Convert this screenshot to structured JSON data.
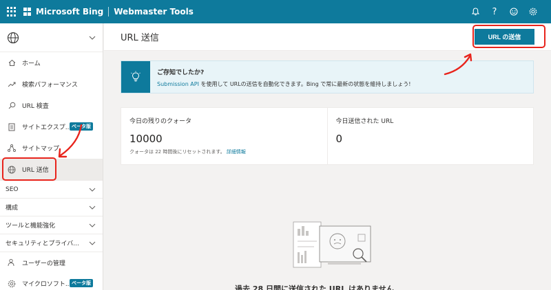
{
  "header": {
    "brand": "Microsoft Bing",
    "product": "Webmaster Tools",
    "icons": [
      "bell-icon",
      "help-icon",
      "smiley-icon",
      "gear-icon"
    ],
    "accent": "#0e7a9c"
  },
  "sidebar": {
    "items": [
      {
        "label": "ホーム",
        "icon": "home-icon"
      },
      {
        "label": "検索パフォーマンス",
        "icon": "trend-icon"
      },
      {
        "label": "URL 検査",
        "icon": "search-icon"
      },
      {
        "label": "サイトエクスプ...",
        "icon": "document-icon",
        "badge": "ベータ版"
      },
      {
        "label": "サイトマップ",
        "icon": "sitemap-icon"
      },
      {
        "label": "URL 送信",
        "icon": "globe-icon",
        "active": true
      }
    ],
    "groups": [
      {
        "label": "SEO"
      },
      {
        "label": "構成"
      },
      {
        "label": "ツールと機能強化"
      },
      {
        "label": "セキュリティとプライバ..."
      }
    ],
    "bottom_items": [
      {
        "label": "ユーザーの管理",
        "icon": "users-icon"
      },
      {
        "label": "マイクロソフト...",
        "icon": "settings-icon",
        "badge": "ベータ版"
      }
    ]
  },
  "main": {
    "title": "URL 送信",
    "submit_button": "URL の送信",
    "tip": {
      "title": "ご存知でしたか?",
      "link": "Submission API",
      "body": " を使用して URLの送信を自動化できます。Bing で常に最新の状態を維持しましょう!"
    },
    "stats": {
      "quota_label": "今日の残りのクォータ",
      "quota_value": "10000",
      "quota_sub": "クォータは 22 時間後にリセットされます。",
      "quota_link": "詳細情報",
      "submitted_label": "今日送信された URL",
      "submitted_value": "0"
    },
    "empty_message": "過去 28 日間に送信された URL はありません"
  }
}
